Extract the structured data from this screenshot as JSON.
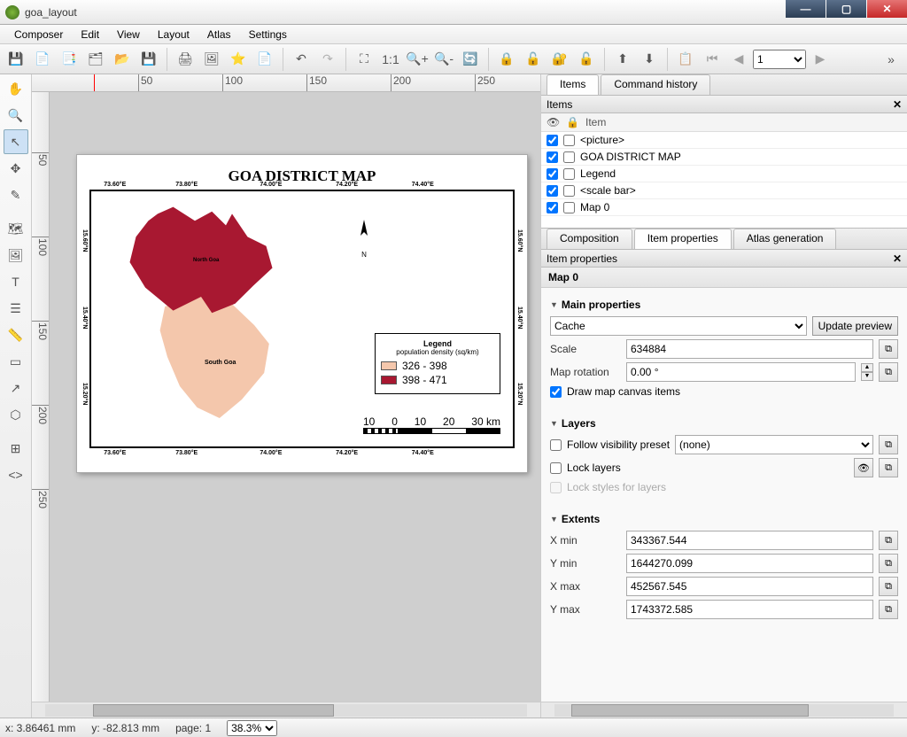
{
  "window": {
    "title": "goa_layout"
  },
  "menu": [
    "Composer",
    "Edit",
    "View",
    "Layout",
    "Atlas",
    "Settings"
  ],
  "toolbar": {
    "page_value": "1"
  },
  "ruler_h": [
    "50",
    "100",
    "150",
    "200",
    "250"
  ],
  "ruler_v": [
    "50",
    "100",
    "150",
    "200",
    "250"
  ],
  "items_panel": {
    "tab_items": "Items",
    "tab_history": "Command history",
    "title": "Items",
    "col_item": "Item",
    "rows": [
      {
        "label": "<picture>"
      },
      {
        "label": "GOA DISTRICT MAP"
      },
      {
        "label": "Legend"
      },
      {
        "label": "<scale bar>"
      },
      {
        "label": "Map 0"
      }
    ]
  },
  "prop_tabs": {
    "composition": "Composition",
    "item_props": "Item properties",
    "atlas": "Atlas generation"
  },
  "prop_panel": {
    "title": "Item properties",
    "item_name": "Map 0",
    "main": {
      "heading": "Main properties",
      "cache": "Cache",
      "update_preview": "Update preview",
      "scale_label": "Scale",
      "scale_value": "634884",
      "rotation_label": "Map rotation",
      "rotation_value": "0.00 °",
      "draw_canvas": "Draw map canvas items"
    },
    "layers": {
      "heading": "Layers",
      "follow_preset": "Follow visibility preset",
      "preset_value": "(none)",
      "lock_layers": "Lock layers",
      "lock_styles": "Lock styles for layers"
    },
    "extents": {
      "heading": "Extents",
      "xmin_label": "X min",
      "xmin": "343367.544",
      "ymin_label": "Y min",
      "ymin": "1644270.099",
      "xmax_label": "X max",
      "xmax": "452567.545",
      "ymax_label": "Y max",
      "ymax": "1743372.585"
    }
  },
  "map_content": {
    "title": "GOA DISTRICT MAP",
    "lon_ticks": [
      "73.60°E",
      "73.80°E",
      "74.00°E",
      "74.20°E",
      "74.40°E"
    ],
    "lat_ticks": [
      "15.60°N",
      "15.40°N",
      "15.20°N"
    ],
    "north_label": "N",
    "district1": "North Goa",
    "district2": "South Goa",
    "legend_title": "Legend",
    "legend_sub": "population density (sq/km)",
    "legend_r1": "326 - 398",
    "legend_r2": "398 - 471",
    "scale_nums": [
      "10",
      "0",
      "10",
      "20",
      "30 km"
    ]
  },
  "status": {
    "x": "x: 3.86461 mm",
    "y": "y: -82.813 mm",
    "page": "page: 1",
    "zoom": "38.3%"
  },
  "colors": {
    "north_goa": "#a81831",
    "south_goa": "#f4c7ac"
  }
}
